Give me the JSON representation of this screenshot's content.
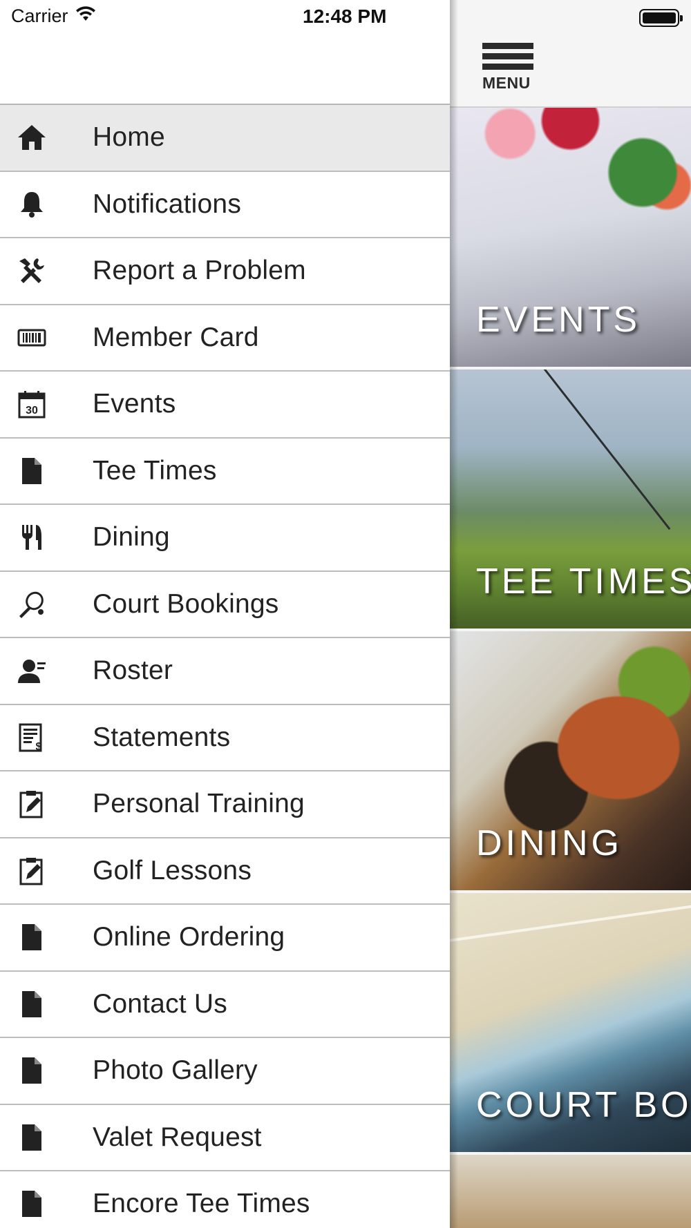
{
  "status_bar": {
    "carrier": "Carrier",
    "time": "12:48 PM"
  },
  "header": {
    "menu_label": "MENU"
  },
  "drawer": {
    "items": [
      {
        "label": "Home",
        "icon": "home-icon",
        "active": true
      },
      {
        "label": "Notifications",
        "icon": "bell-icon"
      },
      {
        "label": "Report a Problem",
        "icon": "tools-icon"
      },
      {
        "label": "Member Card",
        "icon": "barcode-icon"
      },
      {
        "label": "Events",
        "icon": "calendar-icon",
        "icon_text": "30"
      },
      {
        "label": "Tee Times",
        "icon": "document-icon"
      },
      {
        "label": "Dining",
        "icon": "utensils-icon"
      },
      {
        "label": "Court Bookings",
        "icon": "racket-icon"
      },
      {
        "label": "Roster",
        "icon": "user-icon"
      },
      {
        "label": "Statements",
        "icon": "statement-icon"
      },
      {
        "label": "Personal Training",
        "icon": "clipboard-edit-icon"
      },
      {
        "label": "Golf Lessons",
        "icon": "clipboard-edit-icon"
      },
      {
        "label": "Online Ordering",
        "icon": "document-icon"
      },
      {
        "label": "Contact Us",
        "icon": "document-icon"
      },
      {
        "label": "Photo Gallery",
        "icon": "document-icon"
      },
      {
        "label": "Valet Request",
        "icon": "document-icon"
      },
      {
        "label": "Encore Tee Times",
        "icon": "document-icon"
      }
    ]
  },
  "tiles": [
    {
      "title": "EVENTS"
    },
    {
      "title": "TEE TIMES"
    },
    {
      "title": "DINING"
    },
    {
      "title": "COURT BOOKINGS"
    }
  ]
}
